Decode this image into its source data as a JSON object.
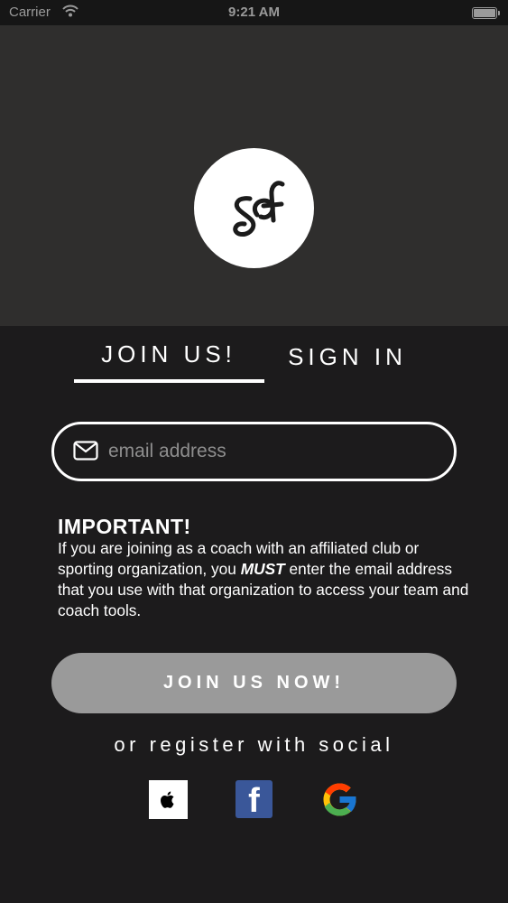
{
  "status_bar": {
    "carrier": "Carrier",
    "time": "9:21 AM"
  },
  "tabs": [
    {
      "label": "JOIN US!",
      "active": true
    },
    {
      "label": "SIGN IN",
      "active": false
    }
  ],
  "email_field": {
    "placeholder": "email address",
    "value": ""
  },
  "notice": {
    "heading": "IMPORTANT!",
    "text_before": "If you are joining as a coach with an affiliated club or sporting organization, you ",
    "emphasis": "MUST",
    "text_after": " enter the email address that you use with that organization to access your team and coach tools."
  },
  "join_button": {
    "label": "JOIN US NOW!"
  },
  "social": {
    "label": "or register with social",
    "providers": [
      "apple-icon",
      "facebook-icon",
      "google-icon"
    ],
    "facebook_letter": "f"
  },
  "colors": {
    "background": "#1c1b1c",
    "hero": "#2f2e2d",
    "button_disabled": "#9a9a9a",
    "facebook": "#3a5799"
  }
}
